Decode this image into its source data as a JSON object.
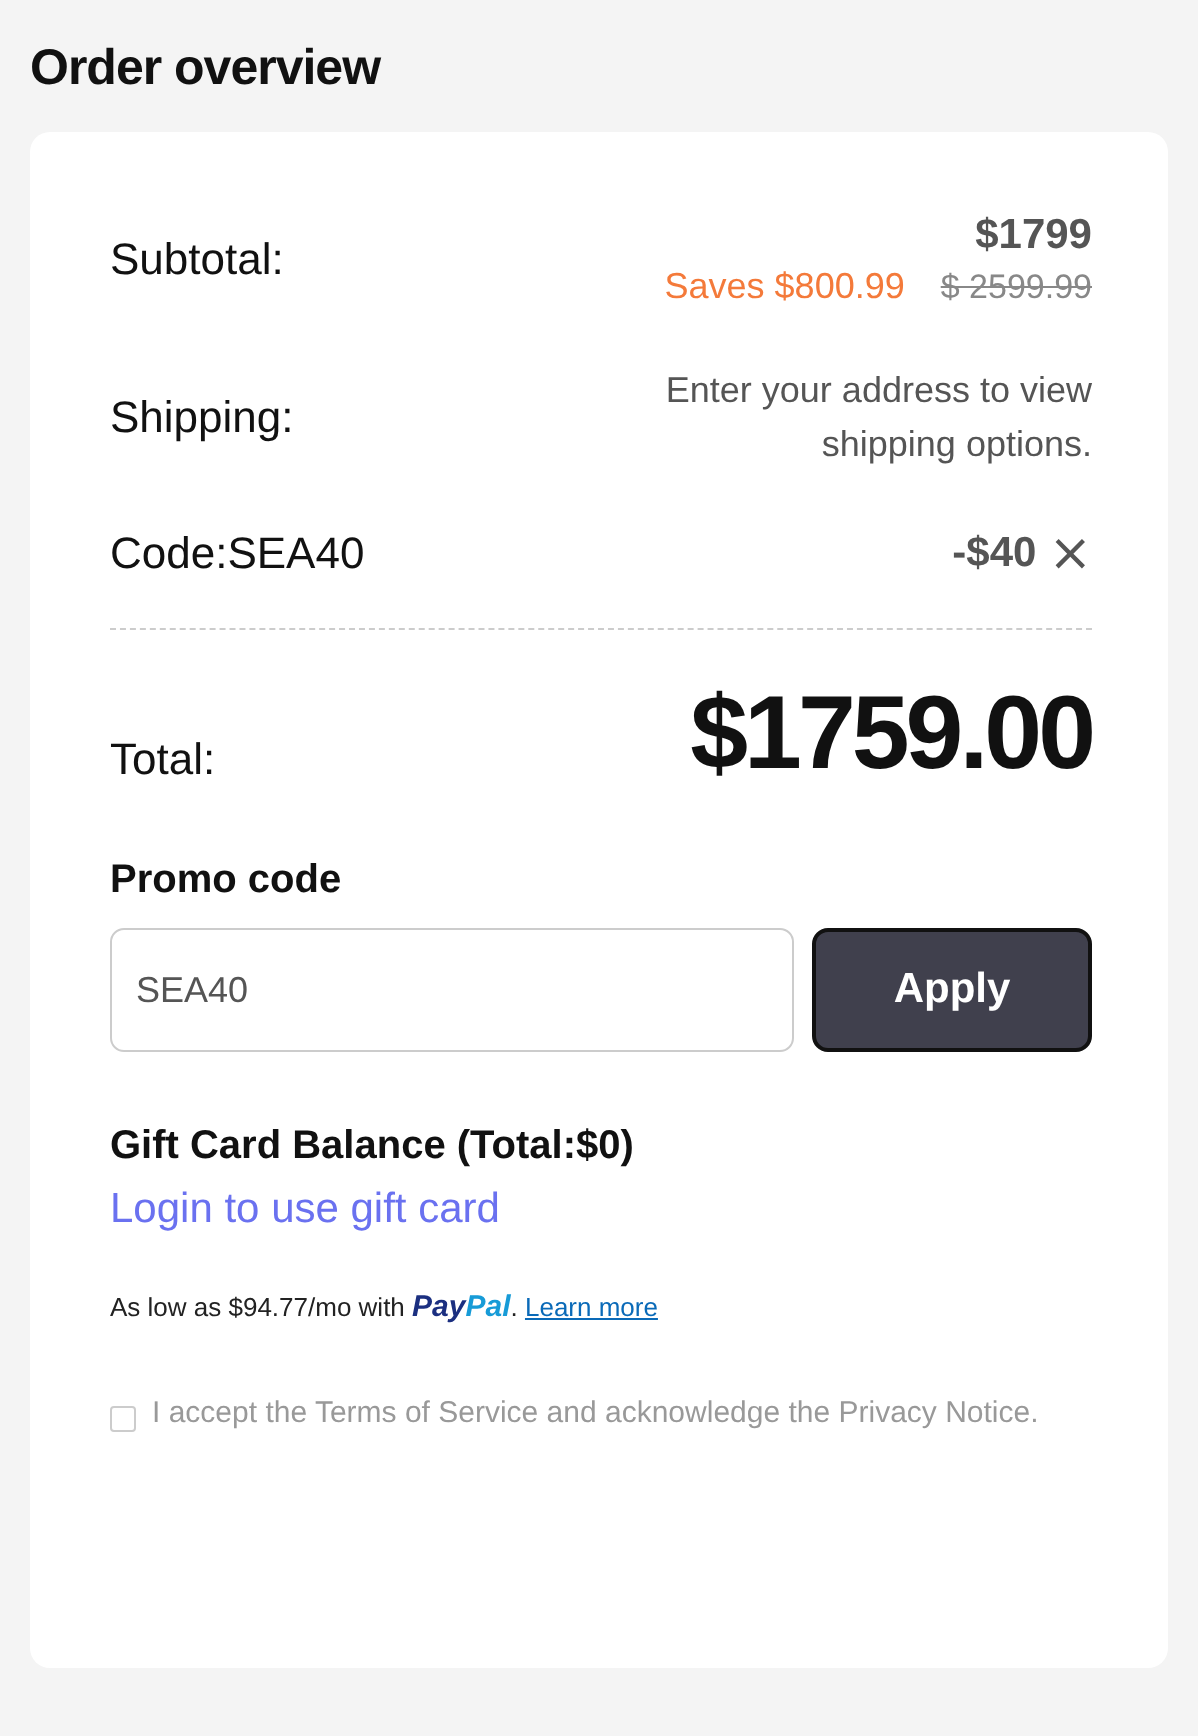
{
  "title": "Order overview",
  "subtotal": {
    "label": "Subtotal:",
    "price": "$1799",
    "savings": "Saves $800.99",
    "original_price": "$ 2599.99"
  },
  "shipping": {
    "label": "Shipping:",
    "note": "Enter your address to view shipping options."
  },
  "code": {
    "label": "Code:SEA40",
    "discount": "-$40",
    "remove": "×"
  },
  "total": {
    "label": "Total:",
    "amount": "$1759.00"
  },
  "promo": {
    "heading": "Promo code",
    "value": "SEA40",
    "button": "Apply"
  },
  "gift_card": {
    "heading": "Gift Card Balance (Total:$0)",
    "link": "Login to use gift card"
  },
  "financing": {
    "text": "As low as $94.77/mo with",
    "logo": [
      "Pay",
      "Pal"
    ],
    "period": ".",
    "link": "Learn more"
  },
  "terms": {
    "checked": false,
    "text": "I accept the Terms of Service and acknowledge the Privacy Notice."
  }
}
